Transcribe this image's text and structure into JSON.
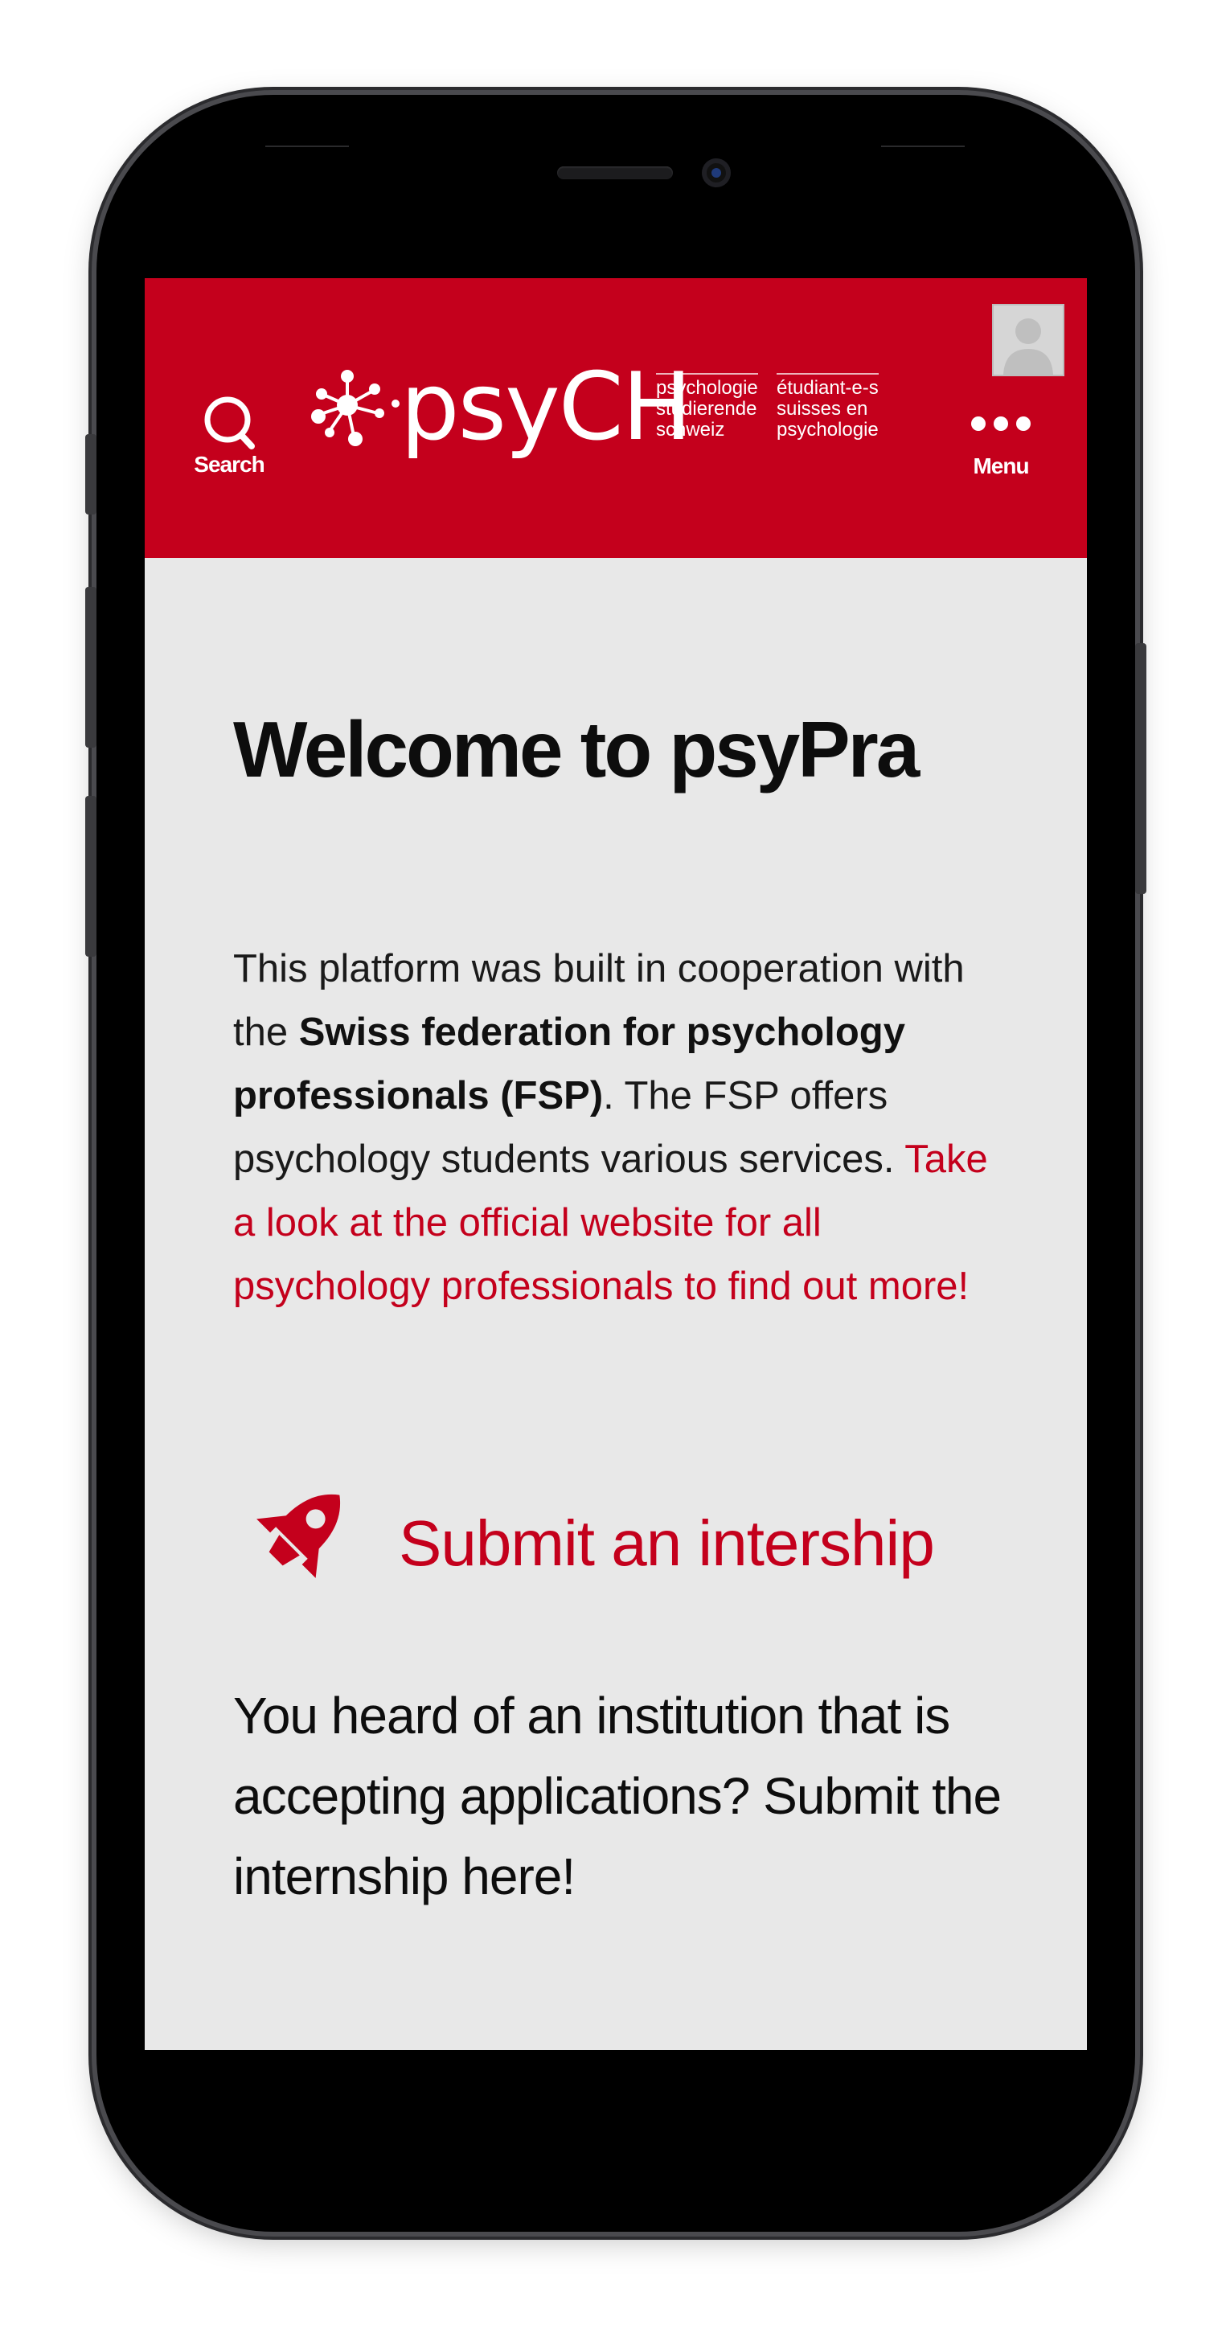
{
  "header": {
    "search_label": "Search",
    "menu_label": "Menu",
    "logo": {
      "name": "psyCH",
      "tagline_de": [
        "psychologie",
        "studierende",
        "schweiz"
      ],
      "tagline_fr": [
        "étudiant-e-s",
        "suisses en",
        "psychologie"
      ]
    }
  },
  "main": {
    "title": "Welcome to psyPra",
    "intro": {
      "part1": "This platform was built in cooperation with the ",
      "bold": "Swiss federation for psychology professionals (FSP)",
      "part2": ". The FSP offers psychology students various services. ",
      "link": "Take a look at the official website for all psychology professionals to find out more!"
    },
    "submit": {
      "label": "Submit an intership",
      "icon": "rocket-icon"
    },
    "submit_description": "You heard of an institution that is accepting applications? Submit the internship here!"
  },
  "colors": {
    "brand_red": "#c4001c",
    "background": "#e8e8e8",
    "text": "#0d0d0d"
  }
}
